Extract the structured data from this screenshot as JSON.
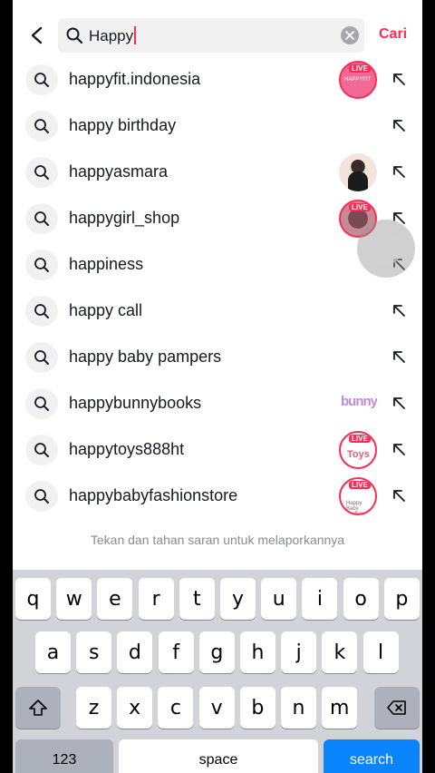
{
  "header": {
    "query": "Happy",
    "action_label": "Cari"
  },
  "suggestions": [
    {
      "label": "happyfit.indonesia",
      "thumb": "live-pink",
      "live": "LIVE",
      "thumb_text": "HAPPYFIT"
    },
    {
      "label": "happy birthday",
      "thumb": "none"
    },
    {
      "label": "happyasmara",
      "thumb": "photo"
    },
    {
      "label": "happygirl_shop",
      "thumb": "live-photo",
      "live": "LIVE"
    },
    {
      "label": "happiness",
      "thumb": "none"
    },
    {
      "label": "happy call",
      "thumb": "none"
    },
    {
      "label": "happy baby pampers",
      "thumb": "none"
    },
    {
      "label": "happybunnybooks",
      "thumb": "logo",
      "thumb_text": "bunny"
    },
    {
      "label": "happytoys888ht",
      "thumb": "live-logo",
      "live": "LIVE",
      "thumb_text": "Toys"
    },
    {
      "label": "happybabyfashionstore",
      "thumb": "live-logo2",
      "live": "LIVE",
      "thumb_text": "Happy Baby Fashion"
    }
  ],
  "hint": "Tekan dan tahan saran untuk melaporkannya",
  "keyboard": {
    "row1": [
      "q",
      "w",
      "e",
      "r",
      "t",
      "y",
      "u",
      "i",
      "o",
      "p"
    ],
    "row2": [
      "a",
      "s",
      "d",
      "f",
      "g",
      "h",
      "j",
      "k",
      "l"
    ],
    "row3": [
      "z",
      "x",
      "c",
      "v",
      "b",
      "n",
      "m"
    ],
    "numbers_label": "123",
    "space_label": "space",
    "search_label": "search"
  },
  "colors": {
    "accent": "#fe2c55",
    "search_key": "#0a84ff"
  },
  "icons": [
    "back-arrow-icon",
    "search-icon",
    "clear-icon",
    "suggestion-search-icon",
    "fill-arrow-icon",
    "shift-icon",
    "delete-icon"
  ]
}
